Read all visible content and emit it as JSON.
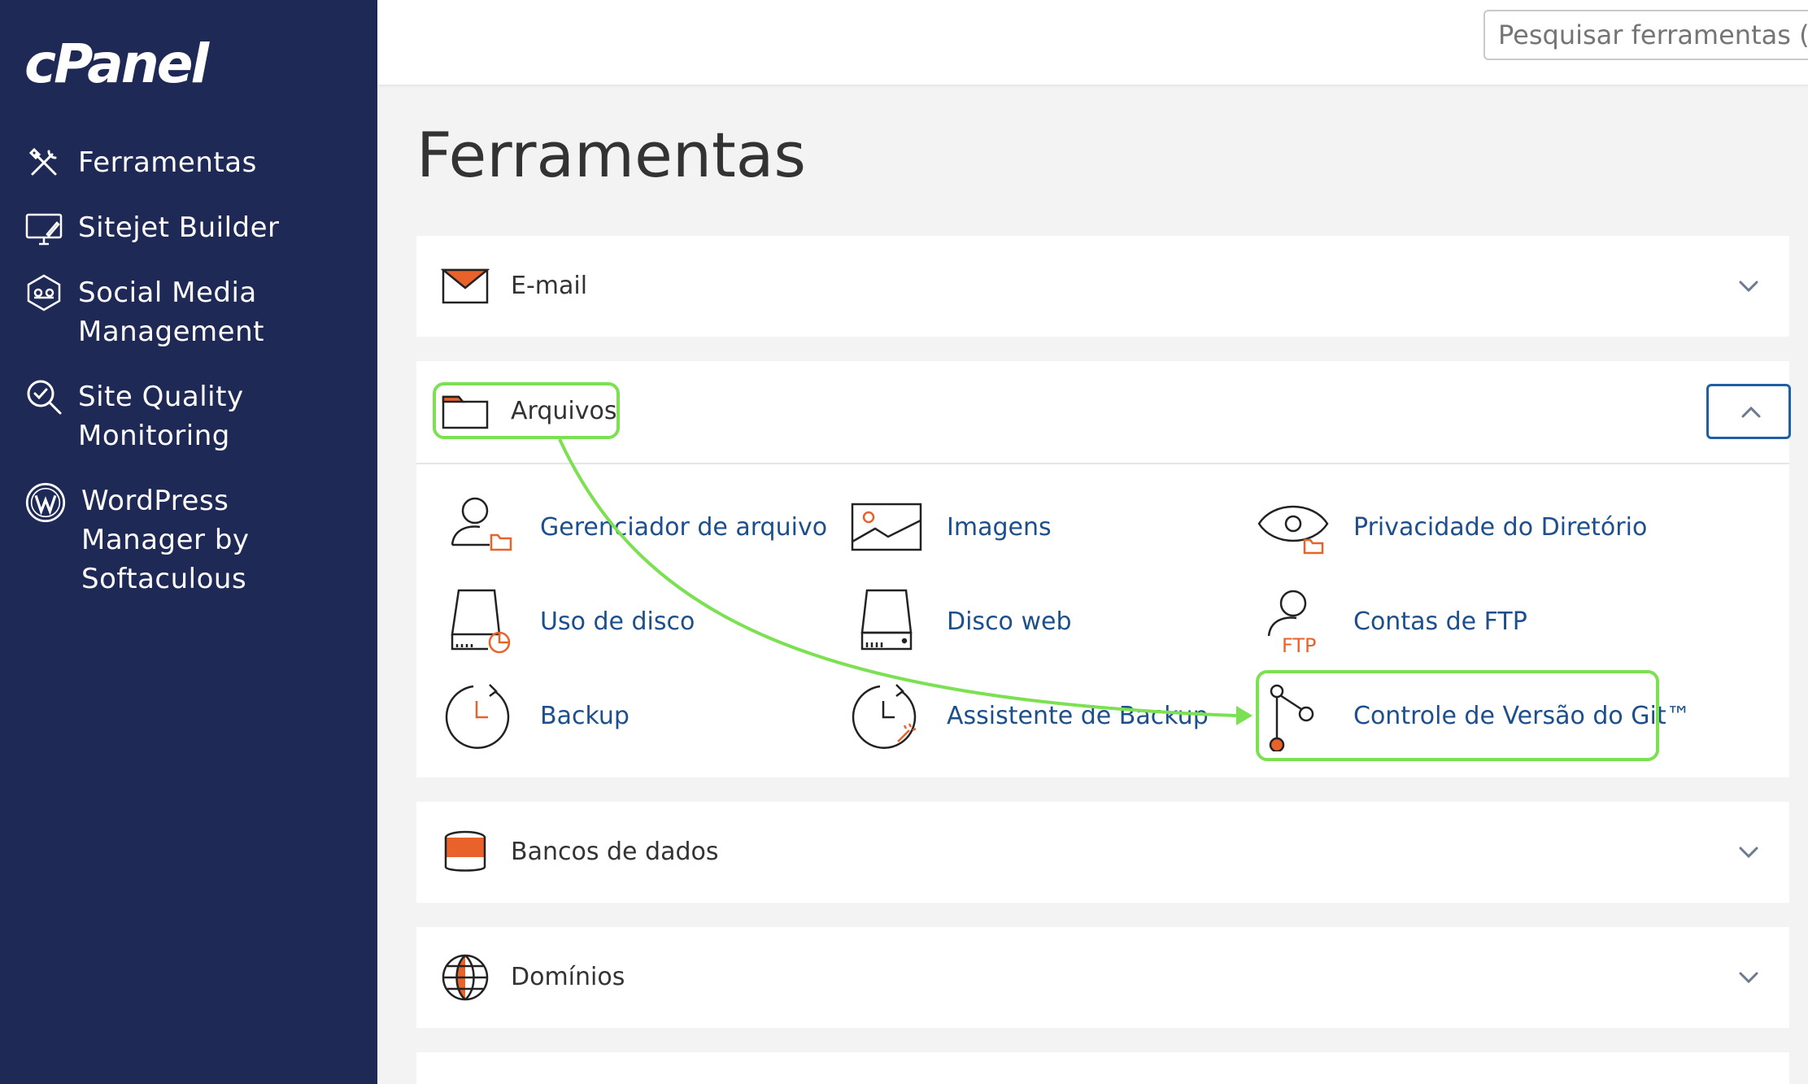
{
  "sidebar": {
    "logo": "cPanel",
    "items": [
      {
        "label": "Ferramentas",
        "icon": "tools-icon"
      },
      {
        "label": "Sitejet Builder",
        "icon": "monitor-pen-icon"
      },
      {
        "label": "Social Media Management",
        "icon": "social-media-icon"
      },
      {
        "label": "Site Quality Monitoring",
        "icon": "search-check-icon"
      },
      {
        "label": "WordPress Manager by Softaculous",
        "icon": "wordpress-icon"
      }
    ]
  },
  "search": {
    "placeholder": "Pesquisar ferramentas (/)"
  },
  "page": {
    "title": "Ferramentas"
  },
  "panels": {
    "email": {
      "title": "E-mail",
      "icon": "envelope-icon"
    },
    "files": {
      "title": "Arquivos",
      "icon": "folder-icon",
      "tools": [
        {
          "label": "Gerenciador de arquivo",
          "icon": "file-manager-icon"
        },
        {
          "label": "Imagens",
          "icon": "image-icon"
        },
        {
          "label": "Privacidade do Diretório",
          "icon": "eye-folder-icon"
        },
        {
          "label": "Uso de disco",
          "icon": "disk-usage-icon"
        },
        {
          "label": "Disco web",
          "icon": "web-disk-icon"
        },
        {
          "label": "Contas de FTP",
          "icon": "ftp-user-icon"
        },
        {
          "label": "Backup",
          "icon": "backup-clock-icon"
        },
        {
          "label": "Assistente de Backup",
          "icon": "backup-wizard-icon"
        },
        {
          "label": "Controle de Versão do Git™",
          "icon": "git-branch-icon"
        }
      ]
    },
    "databases": {
      "title": "Bancos de dados",
      "icon": "database-icon"
    },
    "domains": {
      "title": "Domínios",
      "icon": "globe-icon"
    }
  },
  "colors": {
    "sidebar": "#1f2956",
    "accent_orange": "#e8622a",
    "link_blue": "#1c4f8c",
    "highlight_green": "#7be052"
  }
}
